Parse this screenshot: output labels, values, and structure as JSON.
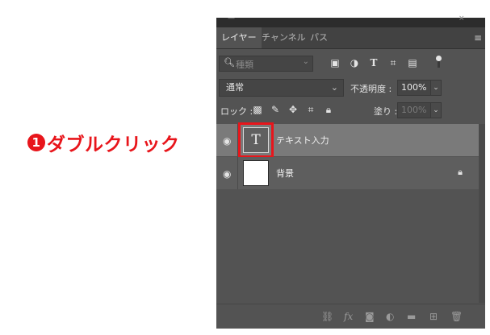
{
  "annotation": {
    "number": "1",
    "text": "ダブルクリック"
  },
  "tabs": [
    {
      "label": "レイヤー",
      "active": true
    },
    {
      "label": "チャンネル",
      "active": false
    },
    {
      "label": "パス",
      "active": false
    }
  ],
  "filter": {
    "kind_label": "種類"
  },
  "blend": {
    "mode": "通常",
    "opacity_label": "不透明度 :",
    "opacity_value": "100%"
  },
  "lock": {
    "label": "ロック :",
    "fill_label": "塗り :",
    "fill_value": "100%"
  },
  "layers": [
    {
      "name": "テキスト入力",
      "thumb": "T",
      "selected": true
    },
    {
      "name": "背景",
      "locked": true
    }
  ],
  "colors": {
    "panel_bg": "#535353",
    "selected_layer": "#7a7a7a",
    "annotation_red": "#e8151b"
  }
}
